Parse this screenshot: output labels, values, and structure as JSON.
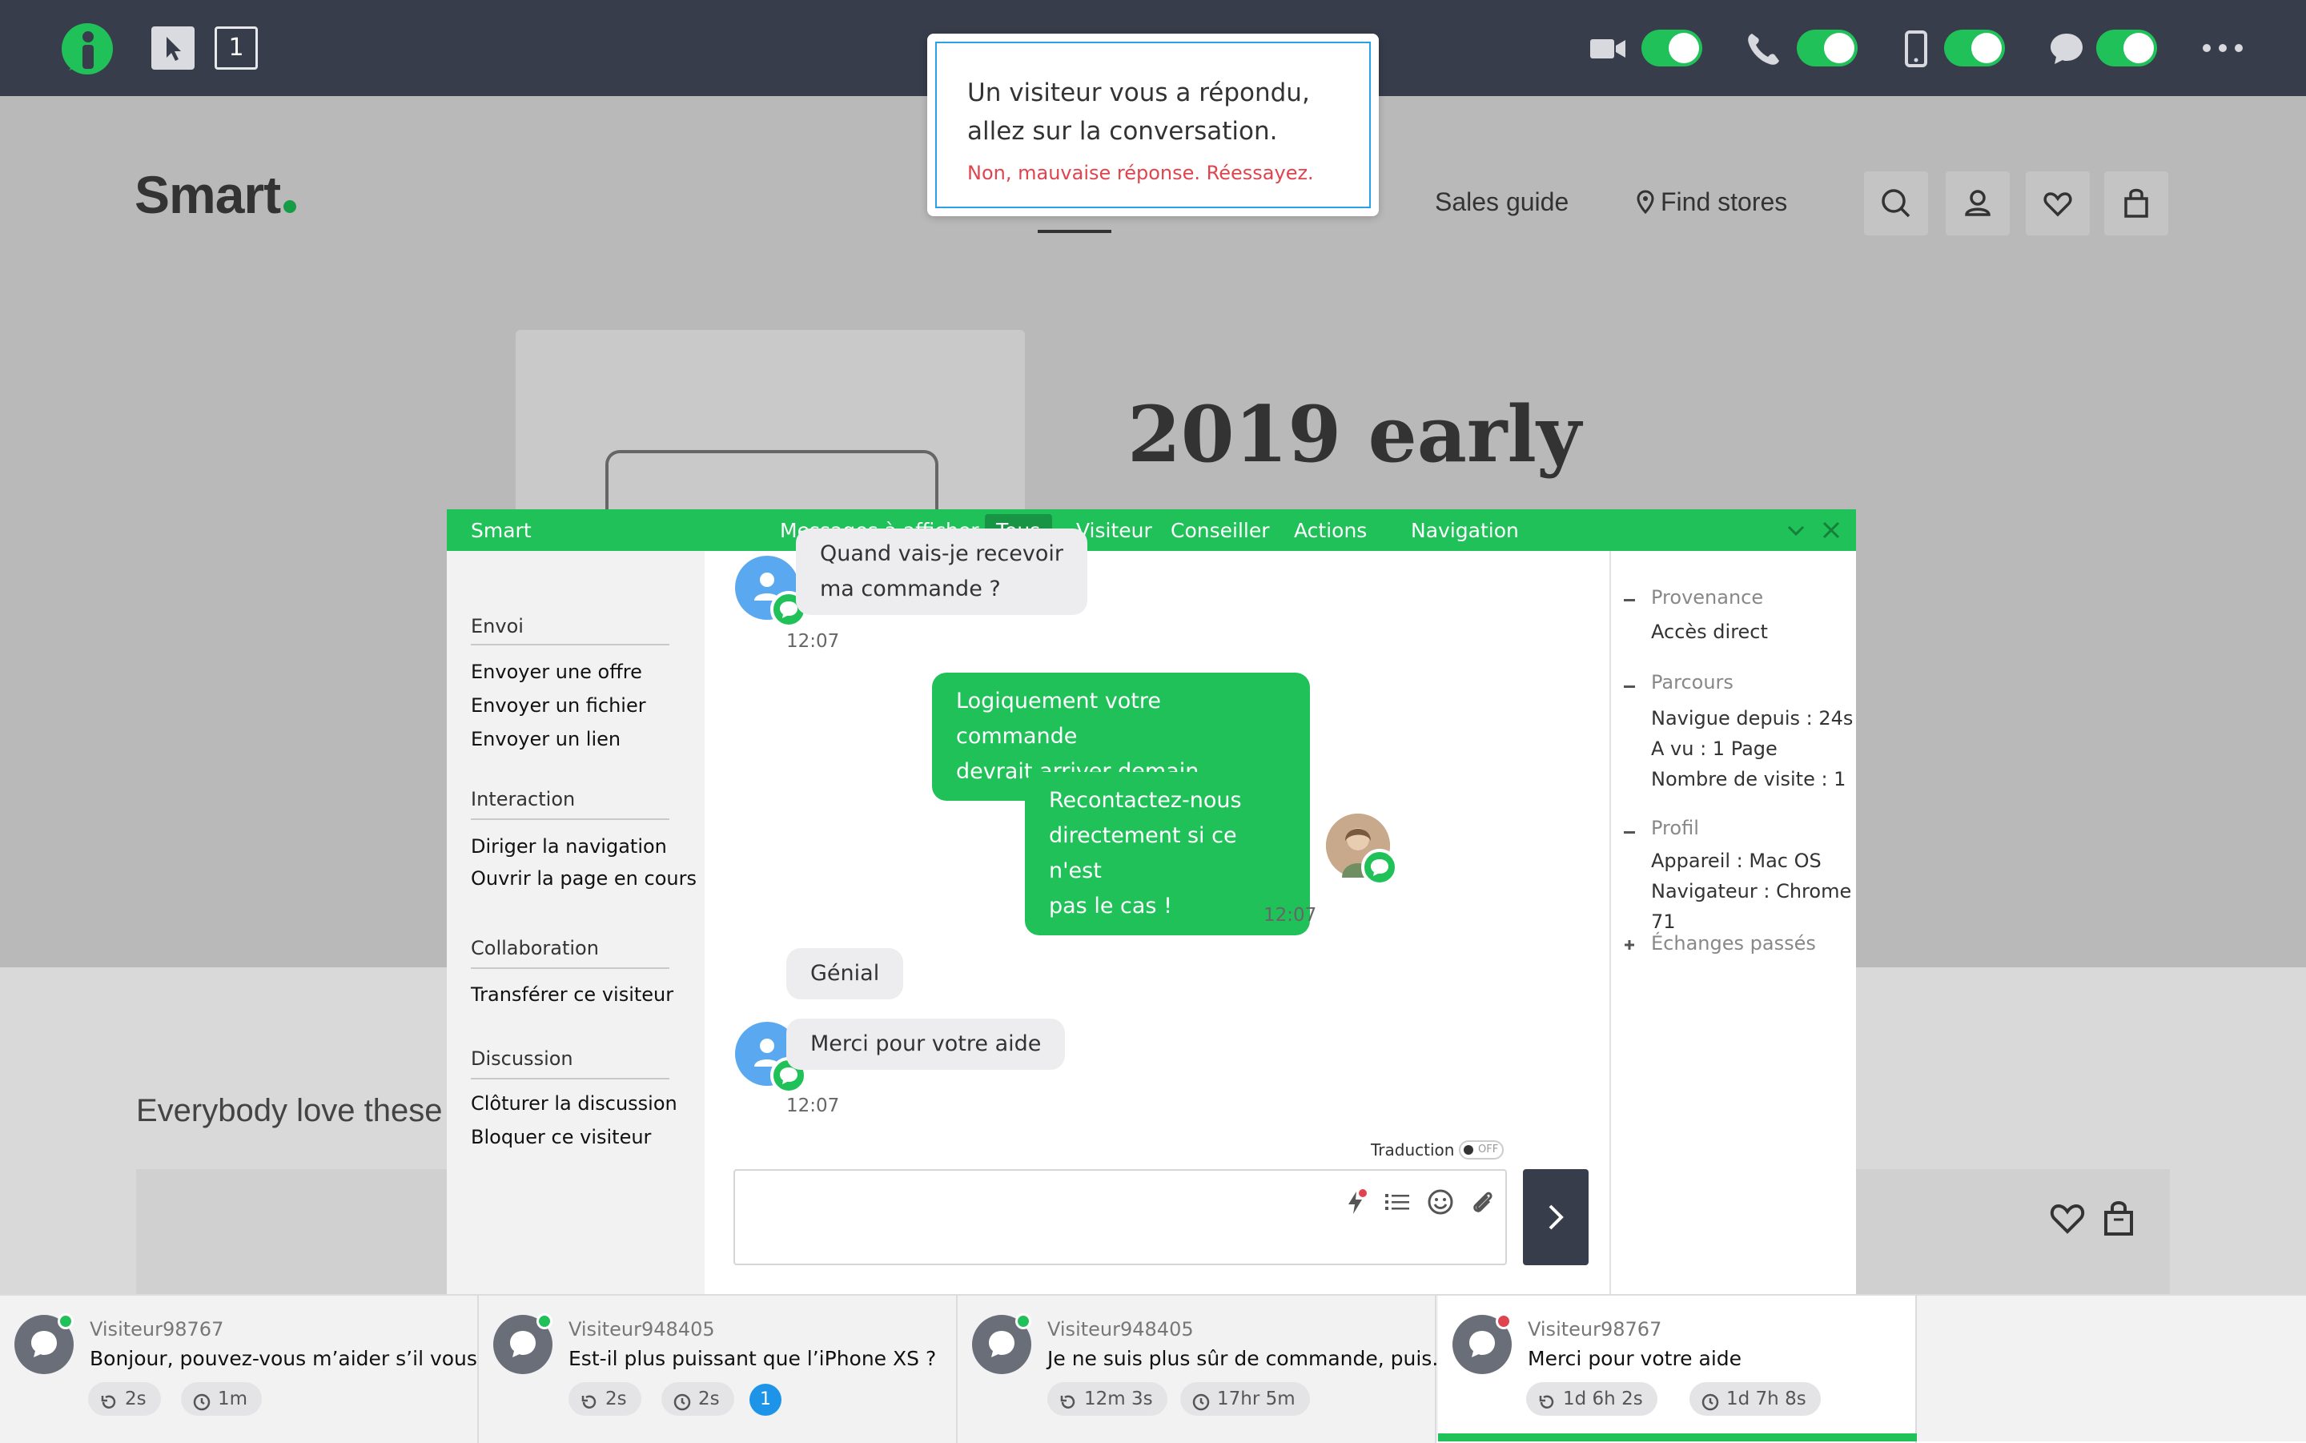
{
  "toolbar": {
    "counter": "1"
  },
  "notification": {
    "title": "Un visiteur vous a répondu, allez sur la conversation.",
    "error": "Non, mauvaise réponse. Réessayez."
  },
  "site": {
    "logo": "Smart",
    "nav": [
      "Sales guide",
      "Find stores"
    ],
    "hero_title": "2019 early",
    "section_title": "Everybody love these"
  },
  "chat": {
    "header": {
      "title": "Smart",
      "filter_label": "Messages à afficher",
      "filters": [
        "Tous",
        "Visiteur",
        "Conseiller"
      ],
      "actions": "Actions",
      "navigation": "Navigation"
    },
    "menu": {
      "sections": [
        {
          "title": "Envoi",
          "items": [
            "Envoyer une offre",
            "Envoyer un fichier",
            "Envoyer un lien"
          ]
        },
        {
          "title": "Interaction",
          "items": [
            "Diriger la navigation",
            "Ouvrir la page en cours"
          ]
        },
        {
          "title": "Collaboration",
          "items": [
            "Transférer ce visiteur"
          ]
        },
        {
          "title": "Discussion",
          "items": [
            "Clôturer la discussion",
            "Bloquer ce visiteur"
          ]
        }
      ]
    },
    "messages": [
      {
        "from": "visitor",
        "lines": [
          "Quand vais-je recevoir",
          "ma commande ?"
        ],
        "time": "12:07"
      },
      {
        "from": "agent",
        "lines": [
          "Logiquement votre commande",
          "devrait arriver demain"
        ]
      },
      {
        "from": "agent",
        "lines": [
          "Recontactez-nous",
          "directement si ce n'est",
          "pas le cas !"
        ],
        "time": "12:07"
      },
      {
        "from": "visitor",
        "lines": [
          "Génial"
        ]
      },
      {
        "from": "visitor",
        "lines": [
          "Merci pour votre aide"
        ],
        "time": "12:07"
      }
    ],
    "translation": {
      "label": "Traduction",
      "state": "OFF"
    },
    "info": {
      "provenance": {
        "title": "Provenance",
        "value": "Accès direct"
      },
      "parcours": {
        "title": "Parcours",
        "lines": [
          "Navigue depuis : 24s",
          "A vu : 1 Page",
          "Nombre de visite : 1"
        ]
      },
      "profil": {
        "title": "Profil",
        "lines": [
          "Appareil : Mac OS",
          "Navigateur : Chrome",
          "71"
        ]
      },
      "echanges": "Échanges passés"
    }
  },
  "tabs": [
    {
      "name": "Visiteur98767",
      "message": "Bonjour, pouvez-vous m’aider s’il vous...",
      "chip1": "2s",
      "chip2": "1m",
      "status": "#21c15a"
    },
    {
      "name": "Visiteur948405",
      "message": "Est-il plus puissant que l’iPhone XS ?",
      "chip1": "2s",
      "chip2": "2s",
      "unread": "1",
      "status": "#21c15a"
    },
    {
      "name": "Visiteur948405",
      "message": "Je ne suis plus sûr de commande, puis...",
      "chip1": "12m 3s",
      "chip2": "17hr 5m",
      "status": "#21c15a"
    },
    {
      "name": "Visiteur98767",
      "message": "Merci pour votre aide",
      "chip1": "1d 6h 2s",
      "chip2": "1d 7h 8s",
      "status": "#e0444e"
    }
  ],
  "colors": {
    "accent": "#21c15a",
    "topbar": "#383d4b",
    "error": "#e0444e",
    "info": "#2aa0e8"
  }
}
